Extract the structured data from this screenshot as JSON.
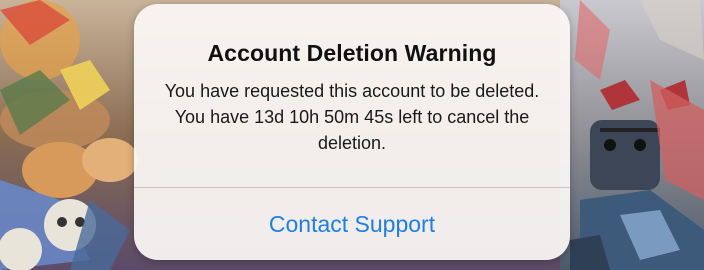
{
  "alert": {
    "title": "Account Deletion Warning",
    "message": "You have requested this account to be deleted. You have 13d 10h 50m 45s left to cancel the deletion.",
    "button_label": "Contact Support"
  },
  "colors": {
    "accent": "#1f7fe0",
    "dialog_background": "#faf7f4",
    "title_text": "#111111"
  }
}
